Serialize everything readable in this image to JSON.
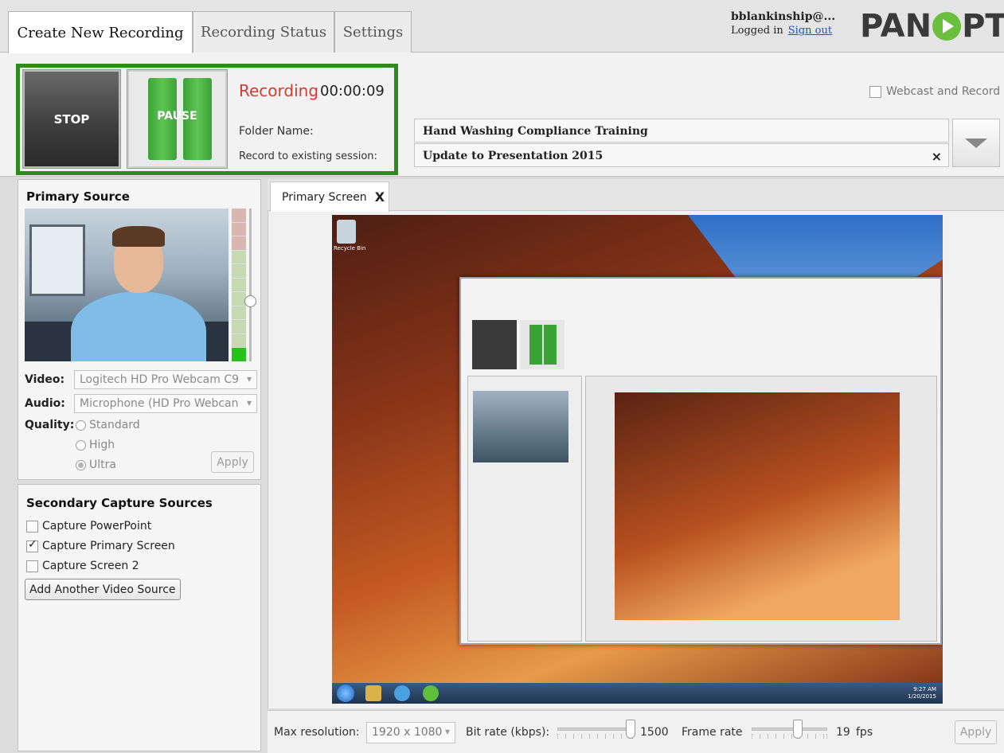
{
  "tabs": [
    {
      "label": "Create New Recording",
      "active": true
    },
    {
      "label": "Recording Status",
      "active": false
    },
    {
      "label": "Settings",
      "active": false
    }
  ],
  "user": {
    "name": "bblankinship@...",
    "logged_in": "Logged in",
    "sign_out": "Sign out"
  },
  "logo": {
    "text_before": "PAN",
    "text_after": "PTO"
  },
  "controls": {
    "stop_label": "STOP",
    "pause_label": "PAUSE",
    "recording_state": "Recording",
    "elapsed": "00:00:09",
    "folder_label": "Folder Name:",
    "existing_label": "Record to existing session:",
    "webcast_label": "Webcast and Record",
    "folder_value": "Hand Washing Compliance Training",
    "session_value": "Update to Presentation 2015",
    "clear_glyph": "×"
  },
  "primary_source": {
    "title": "Primary Source",
    "video_label": "Video:",
    "video_value": "Logitech HD Pro Webcam C9",
    "audio_label": "Audio:",
    "audio_value": "Microphone (HD Pro Webcan",
    "quality_label": "Quality:",
    "quality_options": [
      "Standard",
      "High",
      "Ultra"
    ],
    "quality_selected": "Ultra",
    "apply_label": "Apply"
  },
  "secondary_sources": {
    "title": "Secondary Capture Sources",
    "items": [
      {
        "label": "Capture PowerPoint",
        "checked": false
      },
      {
        "label": "Capture Primary Screen",
        "checked": true
      },
      {
        "label": "Capture Screen 2",
        "checked": false
      }
    ],
    "add_button": "Add Another Video Source"
  },
  "preview": {
    "tab_label": "Primary Screen",
    "tab_close": "X",
    "recycle_label": "Recycle Bin",
    "clock": "9:27 AM\n1/20/2015"
  },
  "bottom_bar": {
    "max_res_label": "Max resolution:",
    "max_res_value": "1920 x 1080",
    "bitrate_label": "Bit rate (kbps):",
    "bitrate_value": "1500",
    "framerate_label": "Frame rate",
    "framerate_value": "19",
    "fps_unit": "fps",
    "apply_label": "Apply"
  },
  "colors": {
    "recording_red": "#d23b2f",
    "highlight_green": "#2e8b1e",
    "pause_green": "#3aa336",
    "link_blue": "#1f4fd6"
  }
}
